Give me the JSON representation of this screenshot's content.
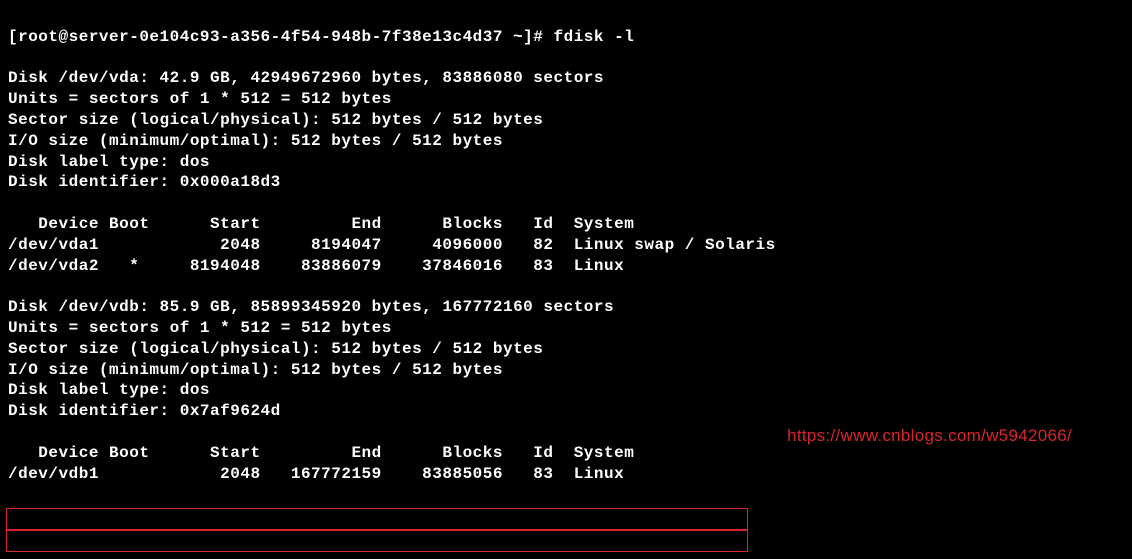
{
  "prompt": {
    "line": "[root@server-0e104c93-a356-4f54-948b-7f38e13c4d37 ~]# fdisk -l"
  },
  "disk1": {
    "header": "Disk /dev/vda: 42.9 GB, 42949672960 bytes, 83886080 sectors",
    "units": "Units = sectors of 1 * 512 = 512 bytes",
    "sector_size": "Sector size (logical/physical): 512 bytes / 512 bytes",
    "io_size": "I/O size (minimum/optimal): 512 bytes / 512 bytes",
    "label_type": "Disk label type: dos",
    "identifier": "Disk identifier: 0x000a18d3"
  },
  "table1": {
    "header": "   Device Boot      Start         End      Blocks   Id  System",
    "row1": "/dev/vda1            2048     8194047     4096000   82  Linux swap / Solaris",
    "row2": "/dev/vda2   *     8194048    83886079    37846016   83  Linux"
  },
  "disk2": {
    "header": "Disk /dev/vdb: 85.9 GB, 85899345920 bytes, 167772160 sectors",
    "units": "Units = sectors of 1 * 512 = 512 bytes",
    "sector_size": "Sector size (logical/physical): 512 bytes / 512 bytes",
    "io_size": "I/O size (minimum/optimal): 512 bytes / 512 bytes",
    "label_type": "Disk label type: dos",
    "identifier": "Disk identifier: 0x7af9624d"
  },
  "table2": {
    "header": "   Device Boot      Start         End      Blocks   Id  System",
    "row1": "/dev/vdb1            2048   167772159    83885056   83  Linux"
  },
  "watermark": {
    "url": "https://www.cnblogs.com/w5942066/"
  },
  "chart_data": {
    "type": "table",
    "disks": [
      {
        "device": "/dev/vda",
        "size_gb": 42.9,
        "size_bytes": 42949672960,
        "sectors": 83886080,
        "sector_size_bytes": 512,
        "io_size_bytes": 512,
        "label_type": "dos",
        "identifier": "0x000a18d3",
        "partitions": [
          {
            "device": "/dev/vda1",
            "boot": false,
            "start": 2048,
            "end": 8194047,
            "blocks": 4096000,
            "id": "82",
            "system": "Linux swap / Solaris"
          },
          {
            "device": "/dev/vda2",
            "boot": true,
            "start": 8194048,
            "end": 83886079,
            "blocks": 37846016,
            "id": "83",
            "system": "Linux"
          }
        ]
      },
      {
        "device": "/dev/vdb",
        "size_gb": 85.9,
        "size_bytes": 85899345920,
        "sectors": 167772160,
        "sector_size_bytes": 512,
        "io_size_bytes": 512,
        "label_type": "dos",
        "identifier": "0x7af9624d",
        "partitions": [
          {
            "device": "/dev/vdb1",
            "boot": false,
            "start": 2048,
            "end": 167772159,
            "blocks": 83885056,
            "id": "83",
            "system": "Linux"
          }
        ]
      }
    ]
  }
}
